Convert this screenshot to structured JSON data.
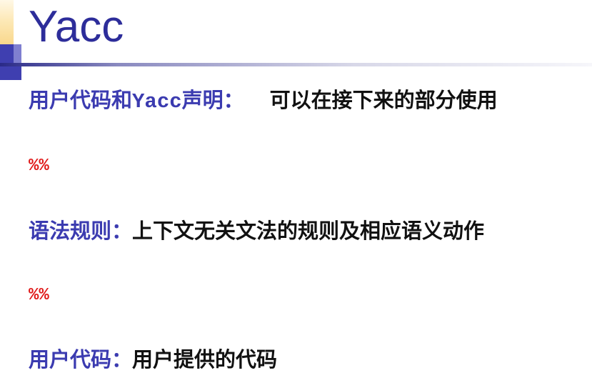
{
  "slide": {
    "title": "Yacc",
    "section1": {
      "label_cn_1": "用户代码和",
      "label_mono": "Yacc",
      "label_cn_2": "声明：",
      "description": "可以在接下来的部分使用"
    },
    "separator1": "%%",
    "section2": {
      "label": "语法规则：",
      "description": "上下文无关文法的规则及相应语义动作"
    },
    "separator2": "%%",
    "section3": {
      "label": "用户代码：",
      "description": "用户提供的代码"
    }
  },
  "colors": {
    "title": "#2d2d9a",
    "label": "#3b3bb0",
    "separator": "#e01818",
    "body_text": "#111111"
  }
}
